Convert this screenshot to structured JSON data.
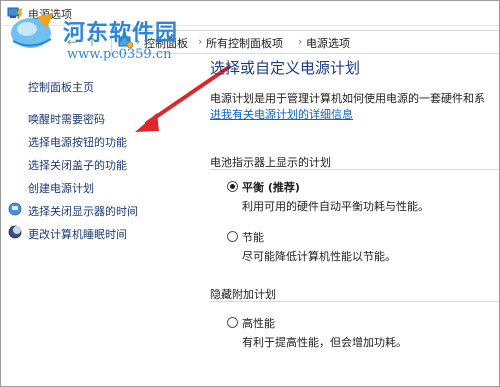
{
  "window": {
    "title": "电源选项"
  },
  "address": {
    "crumbs": [
      "控制面板",
      "所有控制面板项",
      "电源选项"
    ],
    "separator": "›"
  },
  "watermark": {
    "site_name": "河东软件园",
    "url": "www.pc0359.cn"
  },
  "sidebar": {
    "home": "控制面板主页",
    "items": [
      {
        "label": "唤醒时需要密码",
        "icon": null
      },
      {
        "label": "选择电源按钮的功能",
        "icon": null
      },
      {
        "label": "选择关闭盖子的功能",
        "icon": null
      },
      {
        "label": "创建电源计划",
        "icon": null
      },
      {
        "label": "选择关闭显示器的时间",
        "icon": "monitor-icon"
      },
      {
        "label": "更改计算机睡眠时间",
        "icon": "moon-icon"
      }
    ]
  },
  "main": {
    "title": "选择或自定义电源计划",
    "description": "电源计划是用于管理计算机如何使用电源的一套硬件和系",
    "link": "进我有关电源计划的详细信息",
    "battery_section": {
      "heading": "电池指示器上显示的计划",
      "plans": [
        {
          "name": "平衡 (推荐)",
          "description": "利用可用的硬件自动平衡功耗与性能。",
          "selected": true
        },
        {
          "name": "节能",
          "description": "尽可能降低计算机性能以节能。",
          "selected": false
        }
      ]
    },
    "hidden_section": {
      "heading": "隐藏附加计划",
      "plans": [
        {
          "name": "高性能",
          "description": "有利于提高性能，但会增加功耗。",
          "selected": false
        }
      ]
    }
  },
  "colors": {
    "link": "#1c3a78",
    "title": "#1a3e8c",
    "arrow": "#e0262b",
    "watermark": "#2a86d9"
  }
}
